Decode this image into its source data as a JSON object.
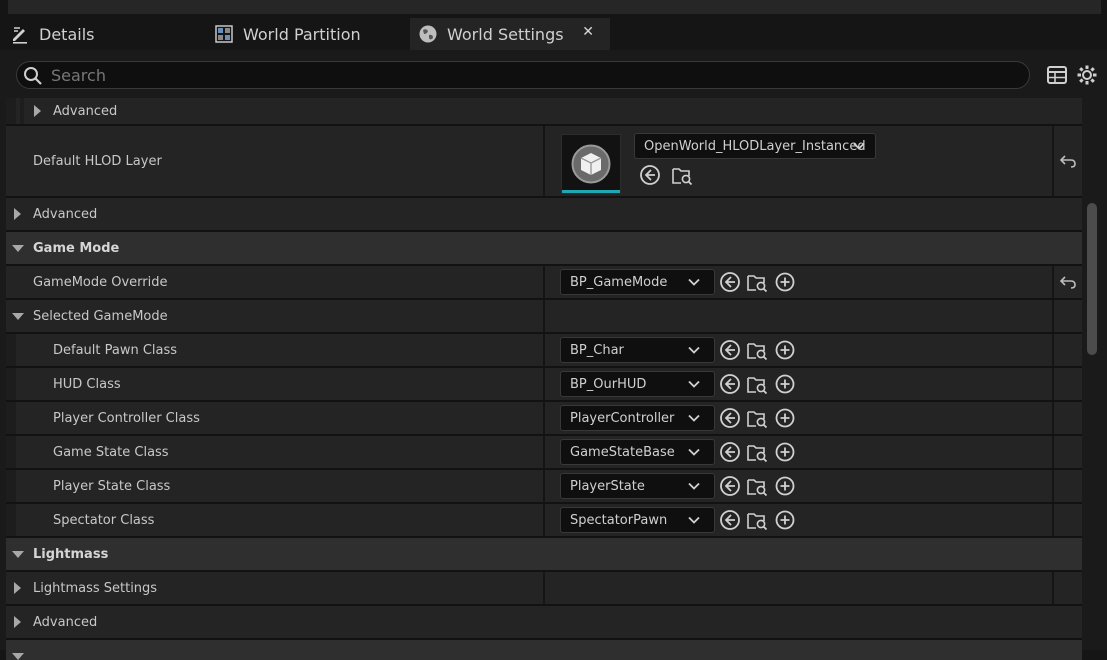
{
  "tabs": [
    {
      "label": "Details",
      "icon": "pencil-icon"
    },
    {
      "label": "World Partition",
      "icon": "grid-map-icon"
    },
    {
      "label": "World Settings",
      "icon": "globe-icon",
      "active": true,
      "close": "✕"
    }
  ],
  "search": {
    "placeholder": "Search"
  },
  "rows": {
    "advanced_top": "Advanced",
    "default_hlod_layer": {
      "label": "Default HLOD Layer",
      "value": "OpenWorld_HLODLayer_Instanced"
    },
    "advanced_1": "Advanced",
    "game_mode": "Game Mode",
    "gamemode_override": {
      "label": "GameMode Override",
      "value": "BP_GameMode"
    },
    "selected_gamemode": "Selected GameMode",
    "default_pawn": {
      "label": "Default Pawn Class",
      "value": "BP_Char"
    },
    "hud_class": {
      "label": "HUD Class",
      "value": "BP_OurHUD"
    },
    "player_controller": {
      "label": "Player Controller Class",
      "value": "PlayerController"
    },
    "game_state": {
      "label": "Game State Class",
      "value": "GameStateBase"
    },
    "player_state": {
      "label": "Player State Class",
      "value": "PlayerState"
    },
    "spectator": {
      "label": "Spectator Class",
      "value": "SpectatorPawn"
    },
    "lightmass": "Lightmass",
    "lightmass_settings": "Lightmass Settings",
    "advanced_2": "Advanced"
  },
  "colors": {
    "accent": "#1fa7b3",
    "background": "#1a1a1a",
    "row": "#242424",
    "category": "#2f2f2f"
  }
}
